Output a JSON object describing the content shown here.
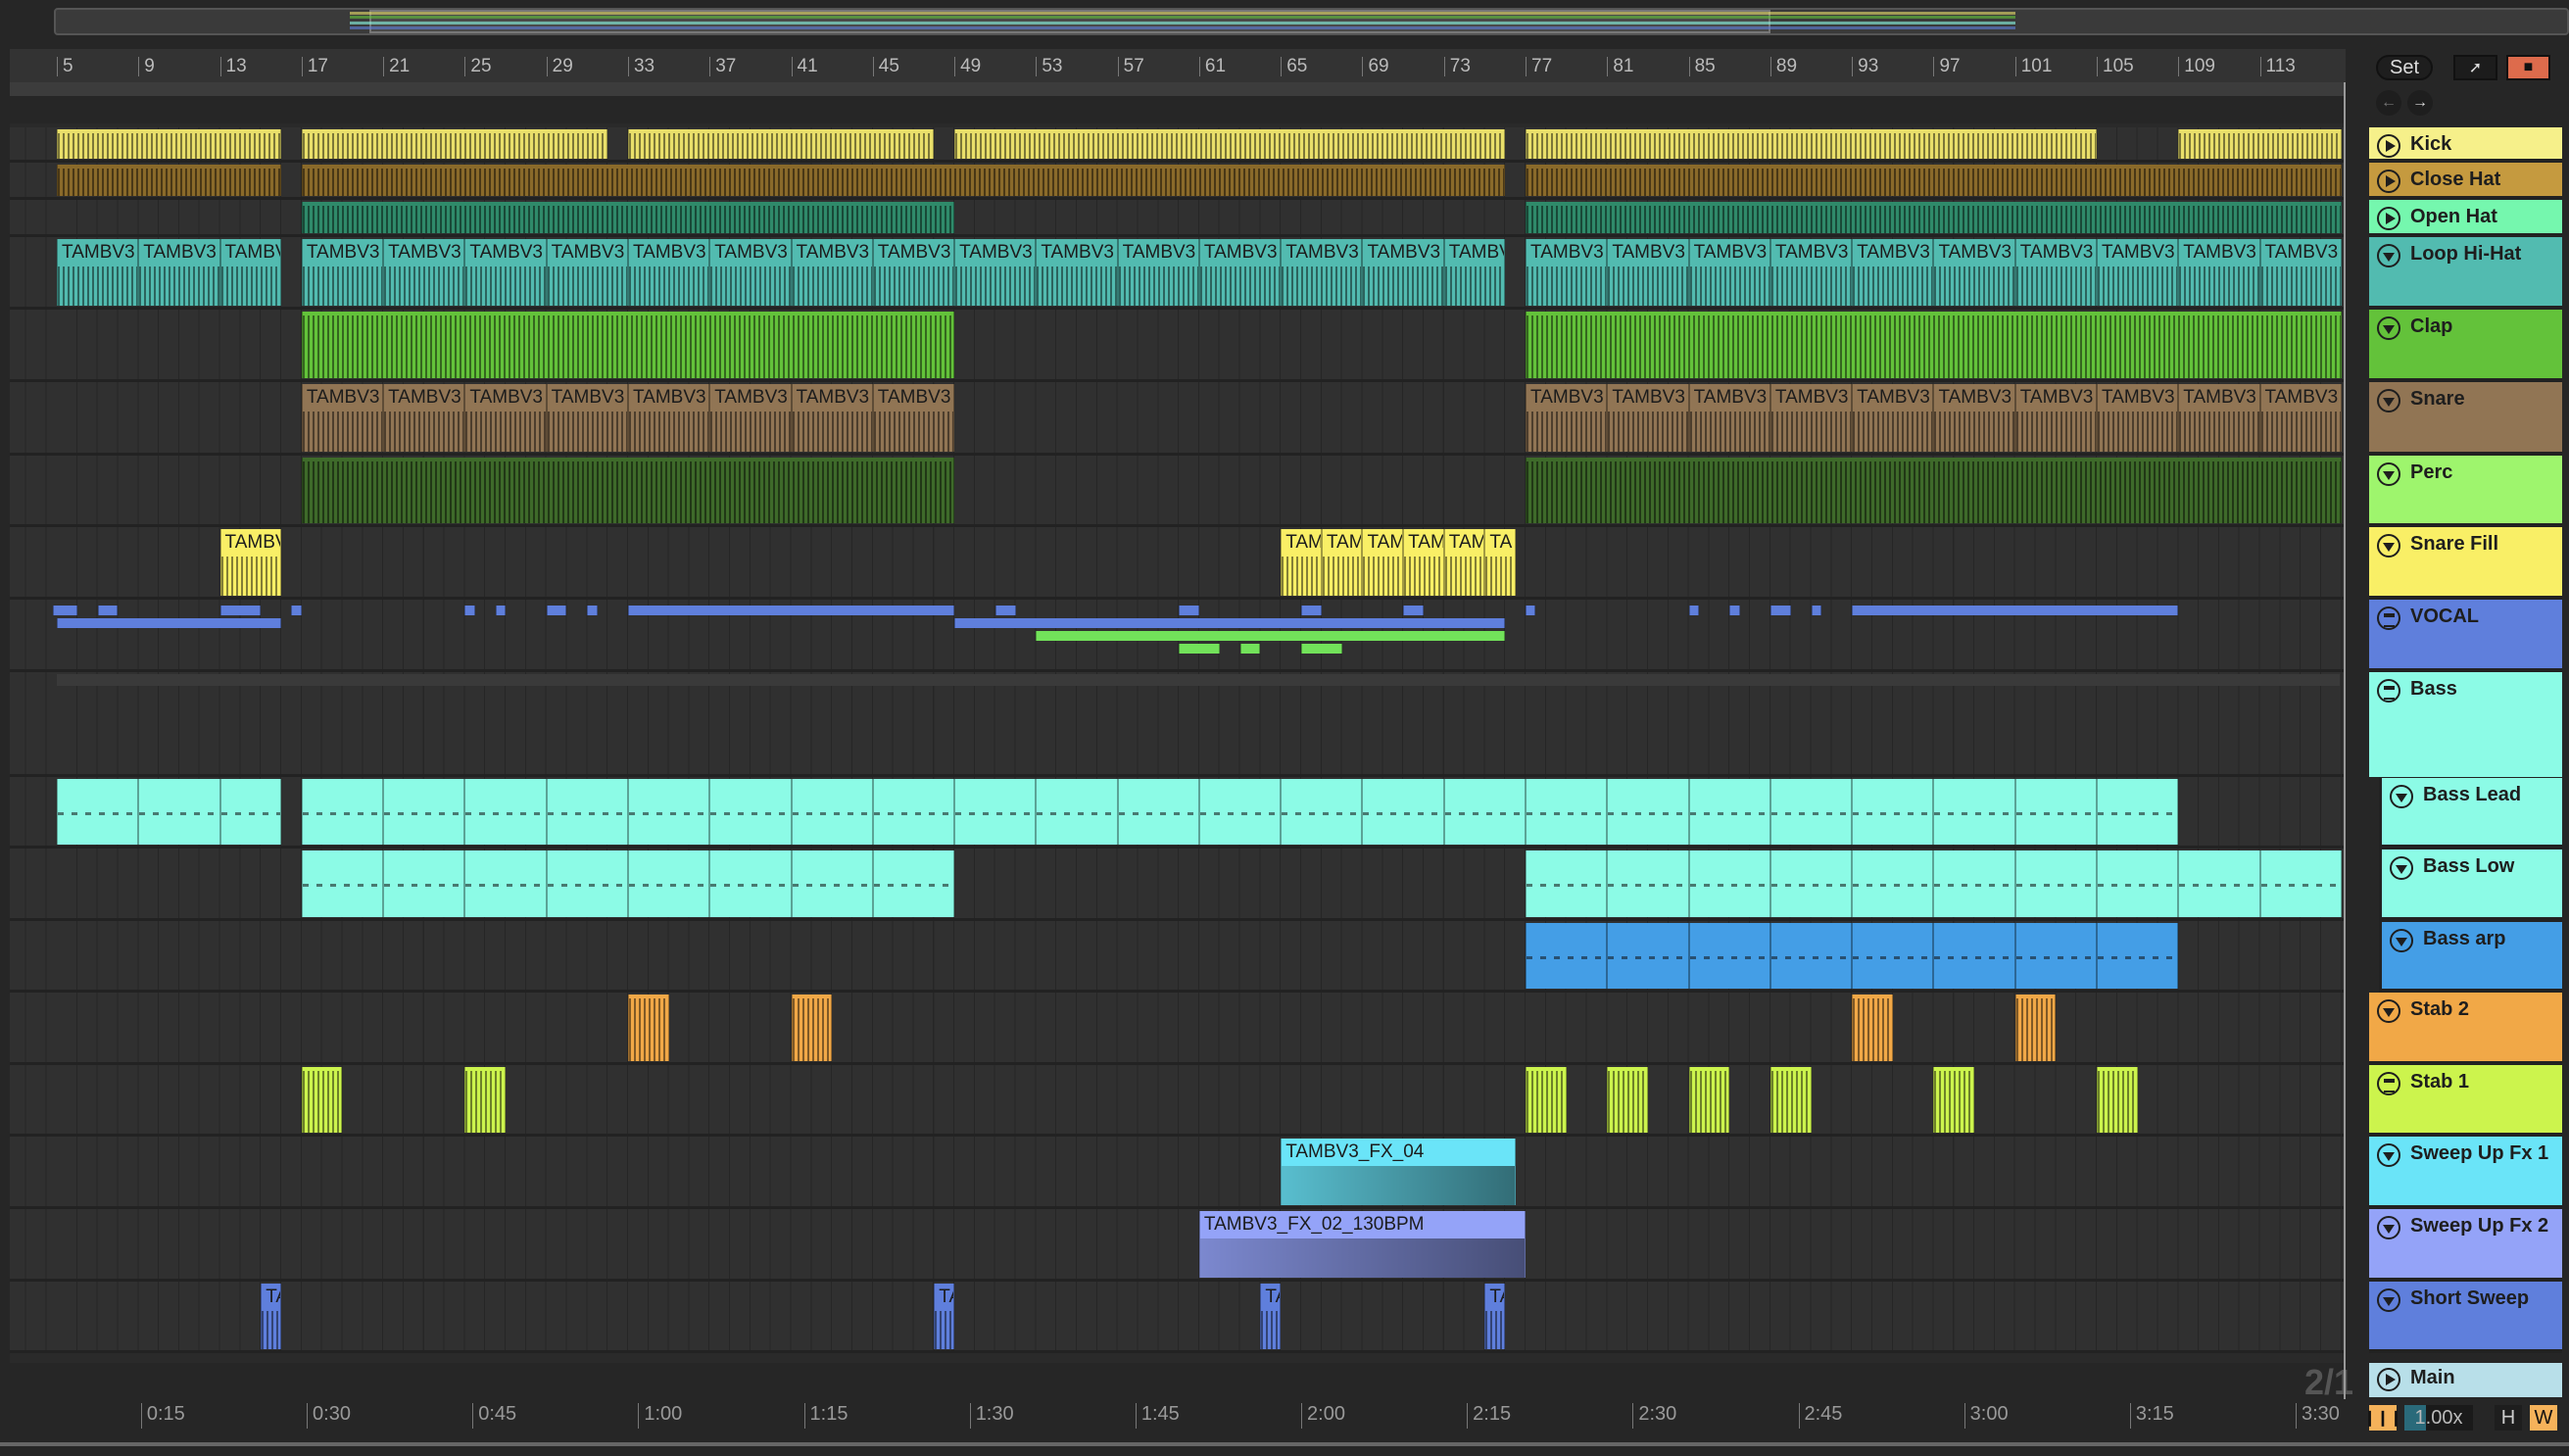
{
  "toolbar": {
    "set_label": "Set",
    "zoom_value": "1.00x",
    "h_label": "H",
    "w_label": "W",
    "time_signature": "2/1"
  },
  "colors": {
    "accent_orange": "#f5b25a",
    "lock_red": "#dd6b4c"
  },
  "ruler": {
    "bars": [
      "5",
      "9",
      "13",
      "17",
      "21",
      "25",
      "29",
      "33",
      "37",
      "41",
      "45",
      "49",
      "53",
      "57",
      "61",
      "65",
      "69",
      "73",
      "77",
      "81",
      "85",
      "89",
      "93",
      "97",
      "101",
      "105",
      "109",
      "113"
    ]
  },
  "time_ruler": {
    "labels": [
      "0:15",
      "0:30",
      "0:45",
      "1:00",
      "1:15",
      "1:30",
      "1:45",
      "2:00",
      "2:15",
      "2:30",
      "2:45",
      "3:00",
      "3:15",
      "3:30"
    ]
  },
  "tracks": [
    {
      "name": "Kick",
      "color": "#f6f08a",
      "icon": "play",
      "clipColor": "#e9df6a",
      "clips": [
        [
          5,
          16
        ],
        [
          17,
          32
        ],
        [
          33,
          48
        ],
        [
          49,
          76
        ],
        [
          77,
          105
        ],
        [
          109,
          117
        ]
      ]
    },
    {
      "name": "Close Hat",
      "color": "#c59a3f",
      "icon": "play",
      "clipColor": "#8a6a2a",
      "clips": [
        [
          5,
          16
        ],
        [
          17,
          76
        ],
        [
          77,
          117
        ]
      ]
    },
    {
      "name": "Open Hat",
      "color": "#75f7ae",
      "icon": "play",
      "clipColor": "#2f8a6a",
      "clips": [
        [
          17,
          49
        ],
        [
          77,
          117
        ]
      ]
    },
    {
      "name": "Loop Hi-Hat",
      "color": "#52bbb0",
      "icon": "fold",
      "clipColor": "#52bbb0",
      "label": "TAMBV3",
      "split": 4,
      "clips": [
        [
          5,
          16
        ],
        [
          17,
          76
        ],
        [
          77,
          117
        ]
      ]
    },
    {
      "name": "Clap",
      "color": "#63c23a",
      "icon": "fold",
      "clipColor": "#63c23a",
      "clips": [
        [
          17,
          49
        ],
        [
          77,
          117
        ]
      ]
    },
    {
      "name": "Snare",
      "color": "#917554",
      "icon": "fold",
      "clipColor": "#917554",
      "label": "TAMBV3",
      "split": 4,
      "clips": [
        [
          17,
          49
        ],
        [
          77,
          117
        ]
      ]
    },
    {
      "name": "Perc",
      "color": "#9ef56d",
      "icon": "fold",
      "clipColor": "#3e6a2a",
      "clips": [
        [
          17,
          49
        ],
        [
          77,
          117
        ]
      ]
    },
    {
      "name": "Snare Fill",
      "color": "#f9ef66",
      "icon": "fold",
      "clipColor": "#f9ef66",
      "clips": [
        [
          13,
          16,
          "TAMBV"
        ],
        [
          65,
          67,
          "TAM"
        ],
        [
          67,
          69,
          "TAM"
        ],
        [
          69,
          71,
          "TAM"
        ],
        [
          71,
          73,
          "TAM"
        ],
        [
          73,
          75,
          "TAM"
        ],
        [
          75,
          76.5,
          "TA"
        ]
      ]
    },
    {
      "name": "VOCAL",
      "color": "#5f7fdc",
      "icon": "group",
      "clipColor": "#5f7fdc",
      "thin": true,
      "clips": [
        [
          4.8,
          6,
          0
        ],
        [
          7,
          8,
          0
        ],
        [
          13,
          15,
          0
        ],
        [
          16.5,
          17,
          0
        ],
        [
          25,
          25.5,
          0
        ],
        [
          26.5,
          27,
          0
        ],
        [
          29,
          30,
          0
        ],
        [
          31,
          31.5,
          0
        ],
        [
          33,
          49,
          0
        ],
        [
          51,
          52,
          0
        ],
        [
          60,
          61,
          0
        ],
        [
          66,
          67,
          0
        ],
        [
          71,
          72,
          0
        ],
        [
          77,
          77.5,
          0
        ],
        [
          85,
          85.5,
          0
        ],
        [
          87,
          87.5,
          0
        ],
        [
          89,
          90,
          0
        ],
        [
          91,
          91.5,
          0
        ],
        [
          93,
          109,
          0
        ],
        [
          5,
          16,
          1
        ],
        [
          49,
          76,
          1
        ],
        [
          53,
          76,
          2,
          "#72e25a"
        ],
        [
          60,
          62,
          3,
          "#72e25a"
        ],
        [
          63,
          64,
          3,
          "#72e25a"
        ],
        [
          66,
          68,
          3,
          "#72e25a"
        ]
      ]
    },
    {
      "name": "Bass",
      "color": "#8cfbe6",
      "icon": "group",
      "clipColor": "#3a3a3a",
      "clips": []
    },
    {
      "name": "Bass Lead",
      "color": "#8cfbe6",
      "icon": "fold",
      "clipColor": "#8cfbe6",
      "sub": true,
      "split": 4,
      "clips": [
        [
          5,
          16
        ],
        [
          17,
          77
        ],
        [
          77,
          109
        ]
      ]
    },
    {
      "name": "Bass Low",
      "color": "#8cfbe6",
      "icon": "fold",
      "clipColor": "#8cfbe6",
      "sub": true,
      "split": 4,
      "clips": [
        [
          17,
          49
        ],
        [
          77,
          117
        ]
      ]
    },
    {
      "name": "Bass arp",
      "color": "#449ee6",
      "icon": "fold",
      "clipColor": "#449ee6",
      "sub": true,
      "split": 4,
      "clips": [
        [
          77,
          109
        ]
      ]
    },
    {
      "name": "Stab 2",
      "color": "#f1a847",
      "icon": "fold",
      "clipColor": "#f1a847",
      "clips": [
        [
          33,
          35
        ],
        [
          41,
          43
        ],
        [
          93,
          95
        ],
        [
          101,
          103
        ]
      ]
    },
    {
      "name": "Stab 1",
      "color": "#ccf44d",
      "icon": "group",
      "clipColor": "#ccf44d",
      "clips": [
        [
          17,
          19
        ],
        [
          25,
          27
        ],
        [
          77,
          79
        ],
        [
          81,
          83
        ],
        [
          85,
          87
        ],
        [
          89,
          91
        ],
        [
          97,
          99
        ],
        [
          105,
          107
        ]
      ]
    },
    {
      "name": "Sweep Up Fx 1",
      "color": "#6ae4f8",
      "icon": "fold",
      "clipColor": "#6ae4f8",
      "clips": [
        [
          65,
          76.5,
          "TAMBV3_FX_04"
        ]
      ]
    },
    {
      "name": "Sweep Up Fx 2",
      "color": "#94a3f8",
      "icon": "fold",
      "clipColor": "#94a3f8",
      "clips": [
        [
          61,
          77,
          "TAMBV3_FX_02_130BPM"
        ]
      ]
    },
    {
      "name": "Short Sweep",
      "color": "#5f7fdc",
      "icon": "fold",
      "clipColor": "#5f7fdc",
      "clips": [
        [
          15,
          16,
          "TA"
        ],
        [
          48,
          49,
          "TA"
        ],
        [
          64,
          65,
          "TA"
        ],
        [
          75,
          76,
          "TA"
        ]
      ]
    }
  ],
  "main": {
    "name": "Main",
    "color": "#b8dfe9"
  }
}
